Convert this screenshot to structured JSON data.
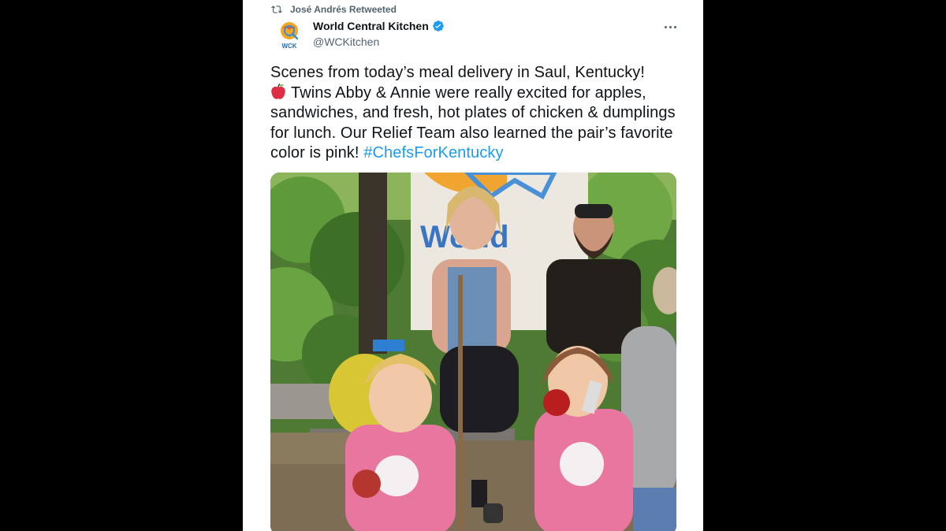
{
  "retweet": {
    "label": "José Andrés Retweeted",
    "icon": "retweet-icon"
  },
  "author": {
    "name": "World Central Kitchen",
    "handle": "@WCKitchen",
    "avatar_text": "WCK",
    "verified": true,
    "verified_color": "#1d9bf0"
  },
  "tweet": {
    "line1": "Scenes from today’s meal delivery in Saul, Kentucky!",
    "emoji": "apple-icon",
    "body": "Twins Abby & Annie were really excited for apples, sandwiches, and fresh, hot plates of chicken & dumplings for lunch. Our Relief Team also learned the pair’s favorite color is pink!",
    "hashtag": "#ChefsForKentucky",
    "hashtag_color": "#1d9bf0"
  },
  "photo": {
    "banner_text": "World",
    "description_icon": "tweet-photo"
  },
  "colors": {
    "background": "#000000",
    "card": "#ffffff",
    "text_primary": "#0f1419",
    "text_secondary": "#536471"
  }
}
